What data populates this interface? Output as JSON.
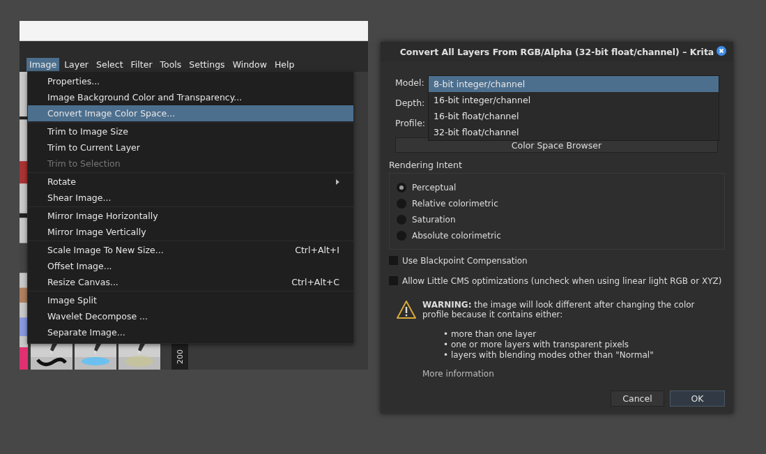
{
  "app_window": {
    "menubar": [
      {
        "label": "Image",
        "selected": true
      },
      {
        "label": "Layer",
        "selected": false
      },
      {
        "label": "Select",
        "selected": false
      },
      {
        "label": "Filter",
        "selected": false
      },
      {
        "label": "Tools",
        "selected": false
      },
      {
        "label": "Settings",
        "selected": false
      },
      {
        "label": "Window",
        "selected": false
      },
      {
        "label": "Help",
        "selected": false
      }
    ],
    "menu": {
      "groups": [
        [
          {
            "label": "Properties...",
            "selected": false,
            "disabled": false
          },
          {
            "label": "Image Background Color and Transparency...",
            "selected": false,
            "disabled": false
          },
          {
            "label": "Convert Image Color Space...",
            "selected": true,
            "disabled": false
          }
        ],
        [
          {
            "label": "Trim to Image Size",
            "selected": false,
            "disabled": false
          },
          {
            "label": "Trim to Current Layer",
            "selected": false,
            "disabled": false
          },
          {
            "label": "Trim to Selection",
            "selected": false,
            "disabled": true
          }
        ],
        [
          {
            "label": "Rotate",
            "selected": false,
            "disabled": false,
            "submenu": true
          },
          {
            "label": "Shear Image...",
            "selected": false,
            "disabled": false
          }
        ],
        [
          {
            "label": "Mirror Image Horizontally",
            "selected": false,
            "disabled": false
          },
          {
            "label": "Mirror Image Vertically",
            "selected": false,
            "disabled": false
          }
        ],
        [
          {
            "label": "Scale Image To New Size...",
            "shortcut": "Ctrl+Alt+I",
            "selected": false,
            "disabled": false
          },
          {
            "label": "Offset Image...",
            "selected": false,
            "disabled": false
          },
          {
            "label": "Resize Canvas...",
            "shortcut": "Ctrl+Alt+C",
            "selected": false,
            "disabled": false
          }
        ],
        [
          {
            "label": "Image Split",
            "selected": false,
            "disabled": false
          },
          {
            "label": "Wavelet Decompose ...",
            "selected": false,
            "disabled": false
          },
          {
            "label": "Separate Image...",
            "selected": false,
            "disabled": false
          }
        ]
      ]
    },
    "ruler": {
      "label": "200"
    }
  },
  "dialog": {
    "title": "Convert All Layers From RGB/Alpha (32-bit float/channel) – Krita",
    "fields": [
      {
        "label": "Model:"
      },
      {
        "label": "Depth:"
      },
      {
        "label": "Profile:"
      }
    ],
    "depth_options": [
      {
        "label": "8-bit integer/channel",
        "selected": true
      },
      {
        "label": "16-bit integer/channel",
        "selected": false
      },
      {
        "label": "16-bit float/channel",
        "selected": false
      },
      {
        "label": "32-bit float/channel",
        "selected": false
      }
    ],
    "browser_button": "Color Space Browser",
    "rendering_intent": {
      "title": "Rendering Intent",
      "options": [
        {
          "label": "Perceptual",
          "selected": true
        },
        {
          "label": "Relative colorimetric",
          "selected": false
        },
        {
          "label": "Saturation",
          "selected": false
        },
        {
          "label": "Absolute colorimetric",
          "selected": false
        }
      ]
    },
    "checkboxes": [
      {
        "label": "Use Blackpoint Compensation",
        "checked": false
      },
      {
        "label": "Allow Little CMS optimizations (uncheck when using linear light RGB or XYZ)",
        "checked": false
      }
    ],
    "warning": {
      "text": "**WARNING:** the image will look different after changing the color profile because it contains either:",
      "bullets": [
        "• more than one layer",
        "• one or more layers with transparent pixels",
        "• layers with blending modes other than \"Normal\""
      ],
      "link": "More information"
    },
    "buttons": [
      {
        "label": "Cancel",
        "default": false
      },
      {
        "label": "OK",
        "default": true
      }
    ]
  }
}
